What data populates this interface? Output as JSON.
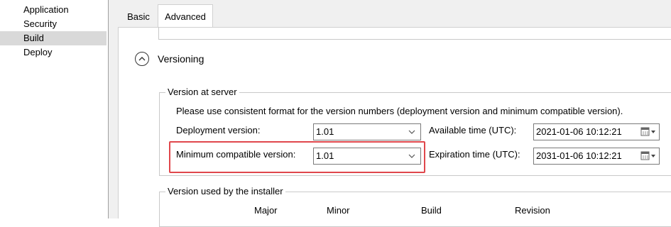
{
  "sidebar": {
    "items": [
      {
        "label": "Application"
      },
      {
        "label": "Security"
      },
      {
        "label": "Build"
      },
      {
        "label": "Deploy"
      }
    ]
  },
  "tabs": [
    {
      "label": "Basic"
    },
    {
      "label": "Advanced"
    }
  ],
  "section": {
    "title": "Versioning",
    "expanded": true
  },
  "version_at_server": {
    "legend": "Version at server",
    "note": "Please use consistent format for the version numbers (deployment version and minimum compatible version).",
    "deployment_version": {
      "label": "Deployment version:",
      "value": "1.01"
    },
    "minimum_compatible_version": {
      "label": "Minimum compatible version:",
      "value": "1.01"
    },
    "available_time": {
      "label": "Available time (UTC):",
      "value": "2021-01-06 10:12:21"
    },
    "expiration_time": {
      "label": "Expiration time (UTC):",
      "value": "2031-01-06 10:12:21"
    }
  },
  "installer_version": {
    "legend": "Version used by the installer",
    "columns": [
      "Major",
      "Minor",
      "Build",
      "Revision"
    ]
  },
  "colors": {
    "highlight": "#e0474c",
    "sidebar_selected": "#d9d9d9",
    "panel_bg": "#f0f0f0"
  }
}
